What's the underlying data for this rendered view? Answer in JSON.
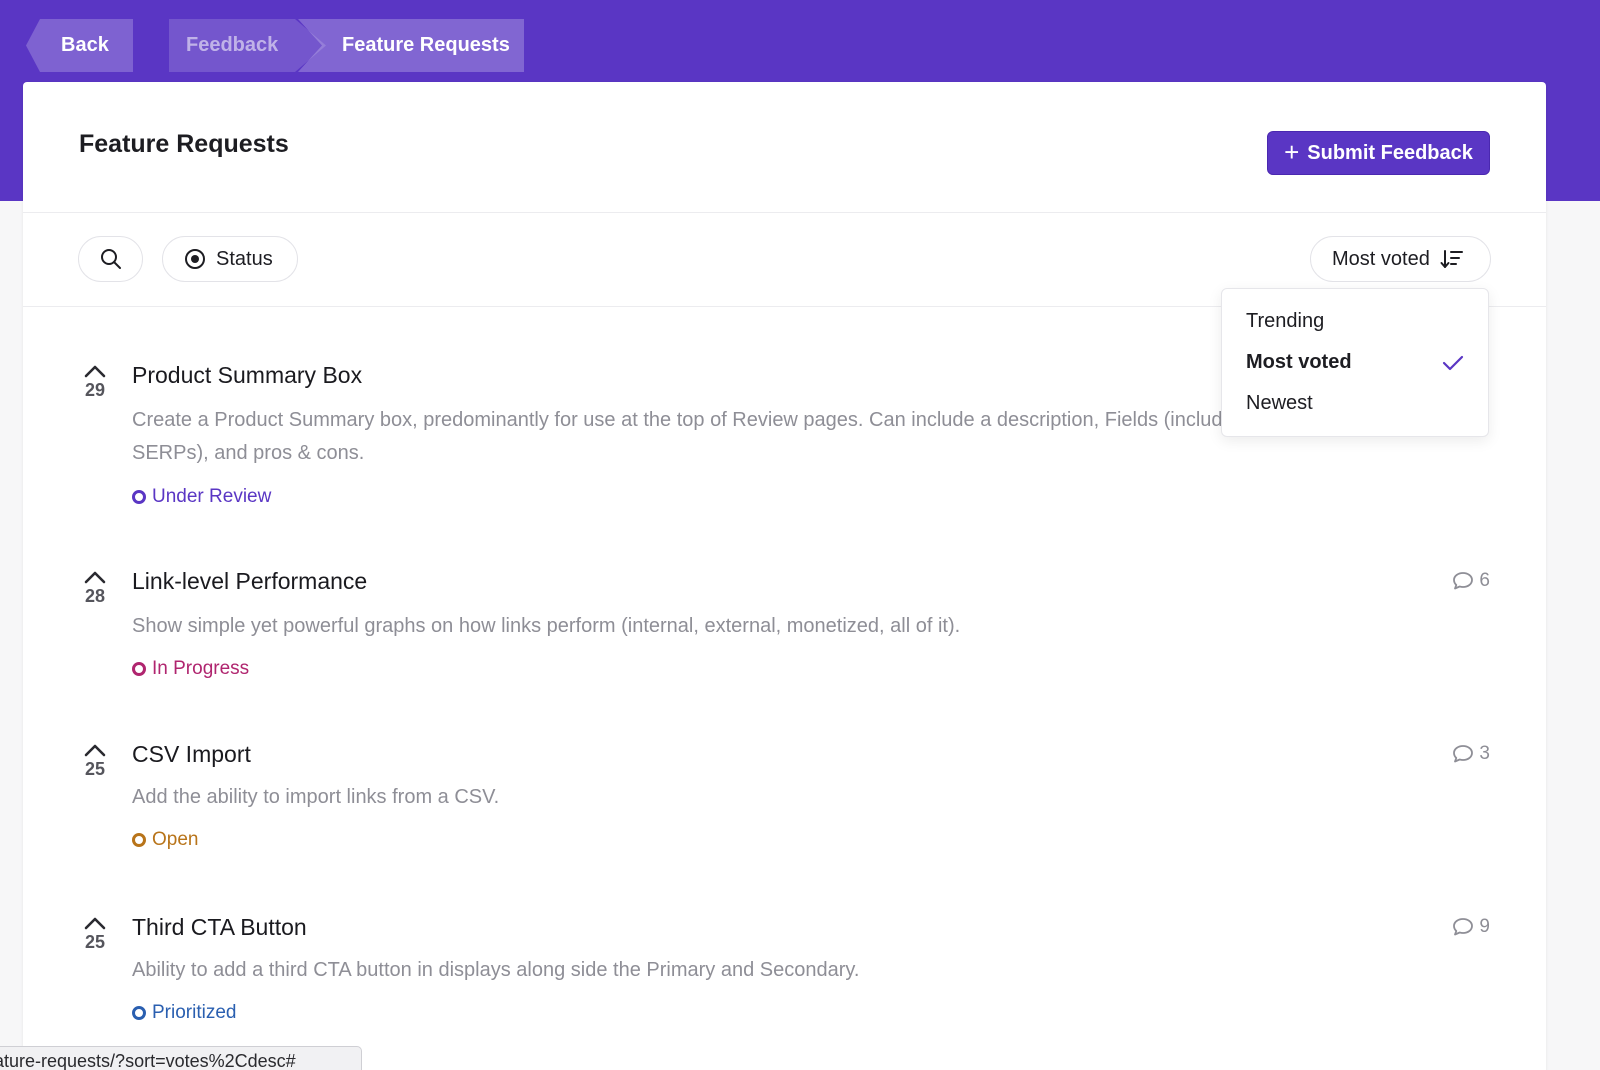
{
  "breadcrumb": {
    "back_label": "Back",
    "items": [
      {
        "label": "Feedback"
      },
      {
        "label": "Feature Requests"
      }
    ]
  },
  "header": {
    "title": "Feature Requests",
    "submit_label": "Submit Feedback"
  },
  "filters": {
    "status_label": "Status",
    "sort_label": "Most voted"
  },
  "sort_menu": {
    "options": [
      {
        "label": "Trending",
        "selected": false
      },
      {
        "label": "Most voted",
        "selected": true
      },
      {
        "label": "Newest",
        "selected": false
      }
    ]
  },
  "items": [
    {
      "votes": "29",
      "title": "Product Summary Box",
      "description": "Create a Product Summary box, predominantly for use at the top of Review pages. Can include a description, Fields (including star ratings for SERPs), and pros & cons.",
      "status": "Under Review",
      "status_color": "#5a36c4",
      "comments": ""
    },
    {
      "votes": "28",
      "title": "Link-level Performance",
      "description": "Show simple yet powerful graphs on how links perform (internal, external, monetized, all of it).",
      "status": "In Progress",
      "status_color": "#b0256f",
      "comments": "6"
    },
    {
      "votes": "25",
      "title": "CSV Import",
      "description": "Add the ability to import links from a CSV.",
      "status": "Open",
      "status_color": "#b8741a",
      "comments": "3"
    },
    {
      "votes": "25",
      "title": "Third CTA Button",
      "description": "Ability to add a third CTA button in displays along side the Primary and Secondary.",
      "status": "Prioritized",
      "status_color": "#2a5fb0",
      "comments": "9"
    }
  ],
  "status_bar": {
    "url": "ature-requests/?sort=votes%2Cdesc#"
  },
  "colors": {
    "brand": "#5a36c4",
    "muted_text": "#8e8e96"
  }
}
